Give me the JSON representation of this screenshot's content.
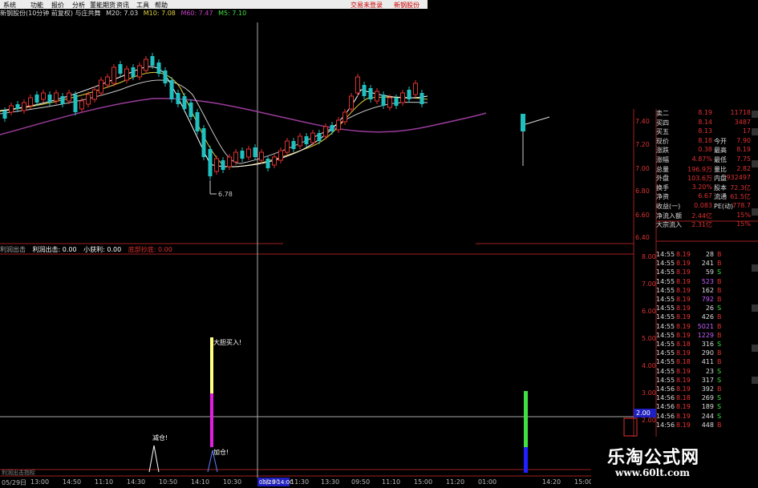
{
  "menu": {
    "items": [
      "系统",
      "功能",
      "报价",
      "分析",
      "董能期货",
      "资讯",
      "工具",
      "帮助"
    ],
    "right_items": [
      "交易未登录",
      "新钢股份"
    ]
  },
  "info": {
    "stock": "新钢股份(10分钟 前复权) 与庄共舞",
    "m20": "M20: 7.03",
    "m10": "M10: 7.08",
    "m60": "M60: 7.47",
    "m5": "M5: 7.10"
  },
  "chart": {
    "low_label": "6.78",
    "cursor_time_label": "05/29 14:00"
  },
  "indicator": {
    "pane_name": "利润出击",
    "v1": "利润出击: 0.00",
    "v2": "小获利: 0.00",
    "v3": "底部抄底: 0.00",
    "label_buy": "大胆买入!",
    "label_reduce": "减仓!",
    "label_add": "加仓!",
    "cursor_value": "2.00",
    "footer_tab": "利润出击指标"
  },
  "time_axis": [
    "05/29日",
    "13:00",
    "14:50",
    "11:10",
    "14:30",
    "10:50",
    "14:10",
    "10:30",
    "10:00",
    "11:30",
    "13:30",
    "09:50",
    "11:10",
    "15:00",
    "11:20",
    "01:00",
    "14:20",
    "15:00"
  ],
  "yaxis_top": [
    "7.40",
    "7.20",
    "7.00",
    "6.80",
    "6.60",
    "6.40"
  ],
  "yaxis_bottom": [
    "8.00",
    "7.00",
    "6.00",
    "5.00",
    "4.00",
    "3.00",
    "2.00",
    "1.00"
  ],
  "quote": [
    {
      "label": "卖二",
      "value": "8.19",
      "extra_label": "",
      "extra": "11718"
    },
    {
      "label": "买四",
      "value": "8.14",
      "extra_label": "",
      "extra": "3487"
    },
    {
      "label": "买五",
      "value": "8.13",
      "extra_label": "",
      "extra": "17"
    },
    {
      "label": "现价",
      "value": "8.18",
      "extra_label": "今开",
      "extra": "7.90"
    },
    {
      "label": "涨跌",
      "value": "0.38",
      "extra_label": "最高",
      "extra": "8.19"
    },
    {
      "label": "涨幅",
      "value": "4.87%",
      "extra_label": "最低",
      "extra": "7.75"
    },
    {
      "label": "总量",
      "value": "196.9万",
      "extra_label": "量比",
      "extra": "2.82"
    },
    {
      "label": "外盘",
      "value": "103.6万",
      "extra_label": "内盘",
      "extra": "932497"
    },
    {
      "label": "换手",
      "value": "3.20%",
      "extra_label": "股本",
      "extra": "72.3亿"
    },
    {
      "label": "净资",
      "value": "6.67",
      "extra_label": "流通",
      "extra": "61.5亿"
    },
    {
      "label": "收益(一)",
      "value": "0.083",
      "extra_label": "PE(动)",
      "extra": "778.7"
    },
    {
      "label": "净流入额",
      "value": "2.44亿",
      "extra_label": "",
      "extra": "15%"
    },
    {
      "label": "大宗流入",
      "value": "2.31亿",
      "extra_label": "",
      "extra": "15%"
    }
  ],
  "ticks": [
    {
      "time": "14:55",
      "price": "8.19",
      "vol": "28",
      "dir": "B"
    },
    {
      "time": "14:55",
      "price": "8.19",
      "vol": "241",
      "dir": "B"
    },
    {
      "time": "14:55",
      "price": "8.19",
      "vol": "59",
      "dir": "S"
    },
    {
      "time": "14:55",
      "price": "8.19",
      "vol": "523",
      "dir": "B"
    },
    {
      "time": "14:55",
      "price": "8.19",
      "vol": "162",
      "dir": "B"
    },
    {
      "time": "14:55",
      "price": "8.19",
      "vol": "792",
      "dir": "B"
    },
    {
      "time": "14:55",
      "price": "8.19",
      "vol": "26",
      "dir": "S"
    },
    {
      "time": "14:55",
      "price": "8.19",
      "vol": "426",
      "dir": "B"
    },
    {
      "time": "14:55",
      "price": "8.19",
      "vol": "5021",
      "dir": "B"
    },
    {
      "time": "14:55",
      "price": "8.19",
      "vol": "1229",
      "dir": "B"
    },
    {
      "time": "14:55",
      "price": "8.18",
      "vol": "316",
      "dir": "S"
    },
    {
      "time": "14:55",
      "price": "8.19",
      "vol": "290",
      "dir": "B"
    },
    {
      "time": "14:55",
      "price": "8.18",
      "vol": "411",
      "dir": "B"
    },
    {
      "time": "14:55",
      "price": "8.19",
      "vol": "23",
      "dir": "S"
    },
    {
      "time": "14:55",
      "price": "8.19",
      "vol": "317",
      "dir": "S"
    },
    {
      "time": "14:56",
      "price": "8.19",
      "vol": "392",
      "dir": "B"
    },
    {
      "time": "14:56",
      "price": "8.18",
      "vol": "269",
      "dir": "S"
    },
    {
      "time": "14:56",
      "price": "8.19",
      "vol": "189",
      "dir": "S"
    },
    {
      "time": "14:56",
      "price": "8.19",
      "vol": "244",
      "dir": "S"
    },
    {
      "time": "14:56",
      "price": "8.19",
      "vol": "448",
      "dir": "B"
    }
  ],
  "watermark": {
    "main": "乐淘公式网",
    "sub": "www.60lt.com"
  },
  "colors": {
    "up": "#e03030",
    "down": "#20c0c0",
    "ma5": "#ffffff",
    "ma10": "#e0d040",
    "ma20": "#c8a0ff",
    "ma60": "#a040a0",
    "buy": "#ffff80",
    "buy2": "#e020e0",
    "green": "#40e040",
    "blue": "#2020ff"
  }
}
